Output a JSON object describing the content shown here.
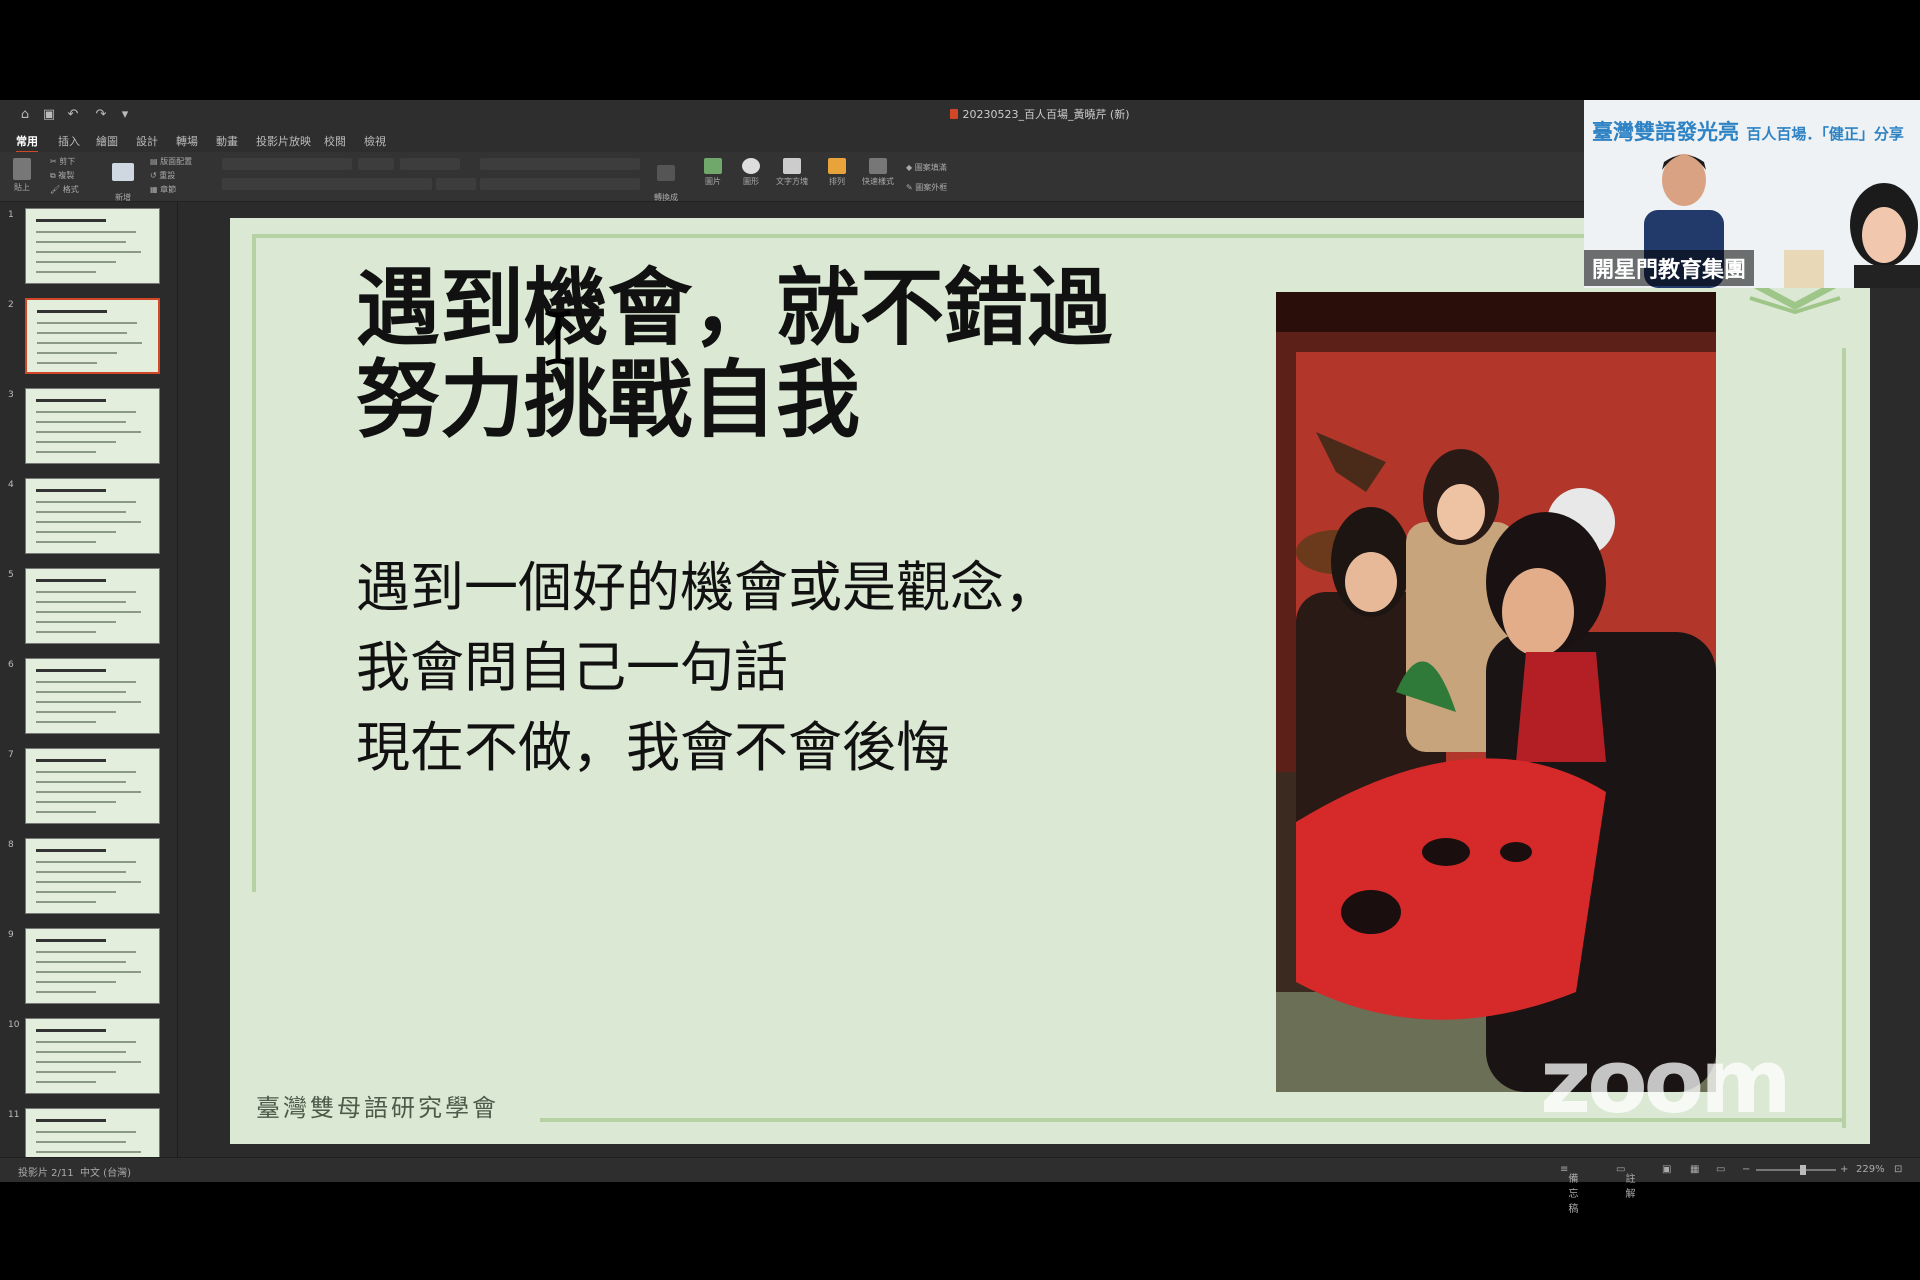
{
  "window": {
    "title": "20230523_百人百場_黃曉芹 (新)"
  },
  "tabs": [
    {
      "label": "常用",
      "active": true
    },
    {
      "label": "插入"
    },
    {
      "label": "繪圖"
    },
    {
      "label": "設計"
    },
    {
      "label": "轉場"
    },
    {
      "label": "動畫"
    },
    {
      "label": "投影片放映"
    },
    {
      "label": "校閱"
    },
    {
      "label": "檢視"
    }
  ],
  "ribbon": {
    "paste": "貼上",
    "cut": "剪下",
    "copy": "複製",
    "format": "格式",
    "new_slide": "新增\n投影片",
    "layout": "版面配置",
    "reset": "重設",
    "section": "章節",
    "convert_smartart": "轉換成\nSmartArt",
    "picture": "圖片",
    "shapes": "圖形",
    "textbox": "文字方塊",
    "arrange": "排列",
    "quick_styles": "快速樣式",
    "shape_fill": "圖案填滿",
    "shape_outline": "圖案外框"
  },
  "thumbnails": [
    {
      "num": "1"
    },
    {
      "num": "2",
      "selected": true
    },
    {
      "num": "3"
    },
    {
      "num": "4"
    },
    {
      "num": "5"
    },
    {
      "num": "6"
    },
    {
      "num": "7"
    },
    {
      "num": "8"
    },
    {
      "num": "9"
    },
    {
      "num": "10"
    },
    {
      "num": "11"
    }
  ],
  "slide": {
    "title_line1": "遇到機會，就不錯過",
    "title_line2": "努力挑戰自我",
    "body_line1": "遇到一個好的機會或是觀念，",
    "body_line2": "我會問自己一句話",
    "body_line3": "現在不做，我會不會後悔",
    "footer": "臺灣雙母語研究學會"
  },
  "status": {
    "slide_position": "投影片 2/11",
    "language": "中文 (台灣)",
    "notes_label": "備忘稿",
    "comments_label": "註解",
    "zoom_level": "229%"
  },
  "video": {
    "banner_main": "臺灣雙語發光亮",
    "banner_sub": "百人百場．「健正」分享",
    "participant_name": "開星門教育集團"
  },
  "watermark": "zoom",
  "colors": {
    "accent": "#d24726",
    "slide_bg": "#dbe8d3",
    "frame": "#b6d1a3",
    "banner_blue": "#2f83c4"
  }
}
